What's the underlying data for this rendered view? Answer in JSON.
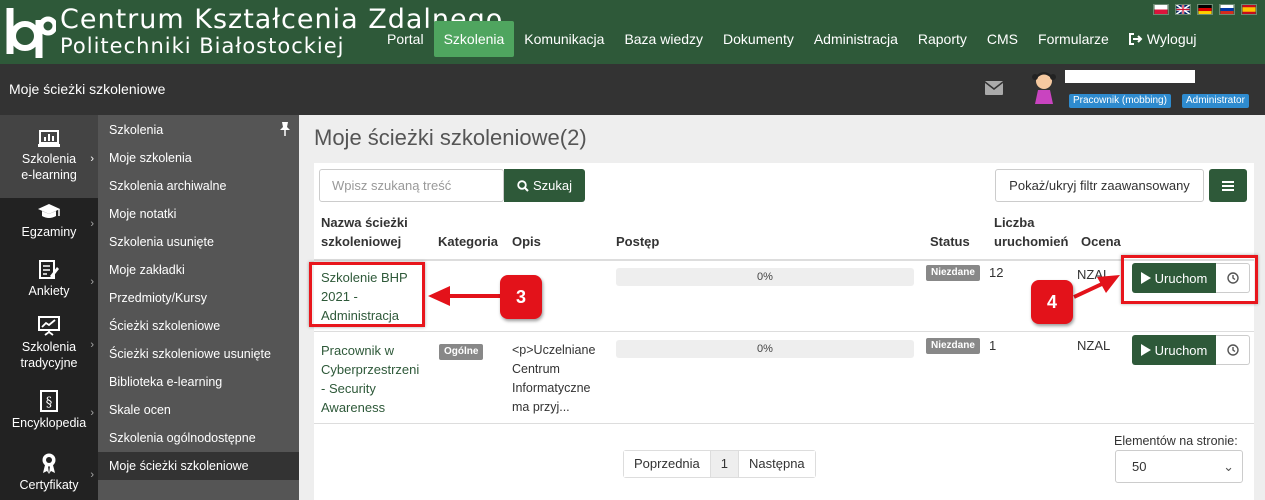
{
  "brand": {
    "line1": "Centrum Kształcenia Zdalnego",
    "line2": "Politechniki Białostockiej"
  },
  "nav": [
    {
      "label": "Portal",
      "active": false
    },
    {
      "label": "Szkolenia",
      "active": true
    },
    {
      "label": "Komunikacja",
      "active": false
    },
    {
      "label": "Baza wiedzy",
      "active": false
    },
    {
      "label": "Dokumenty",
      "active": false
    },
    {
      "label": "Administracja",
      "active": false
    },
    {
      "label": "Raporty",
      "active": false
    },
    {
      "label": "CMS",
      "active": false
    },
    {
      "label": "Formularze",
      "active": false
    },
    {
      "label": "Wyloguj",
      "active": false
    }
  ],
  "flags": [
    "flag-pl-icon",
    "flag-uk-icon",
    "flag-de-icon",
    "flag-ru-icon",
    "flag-es-icon"
  ],
  "subheader": {
    "title": "Moje ścieżki szkoleniowe"
  },
  "user": {
    "badges": [
      "Pracownik (mobbing)",
      "Administrator"
    ]
  },
  "iconbar": [
    {
      "label1": "Szkolenia",
      "label2": "e-learning",
      "icon": "elearning-icon",
      "active": true
    },
    {
      "label1": "Egzaminy",
      "label2": "",
      "icon": "graduation-cap-icon",
      "active": false
    },
    {
      "label1": "Ankiety",
      "label2": "",
      "icon": "survey-icon",
      "active": false
    },
    {
      "label1": "Szkolenia",
      "label2": "tradycyjne",
      "icon": "presentation-icon",
      "active": false
    },
    {
      "label1": "Encyklopedia",
      "label2": "",
      "icon": "encyclopedia-icon",
      "active": false
    },
    {
      "label1": "Certyfikaty",
      "label2": "",
      "icon": "certificate-icon",
      "active": false
    }
  ],
  "submenu": [
    "Szkolenia",
    "Moje szkolenia",
    "Szkolenia archiwalne",
    "Moje notatki",
    "Szkolenia usunięte",
    "Moje zakładki",
    "Przedmioty/Kursy",
    "Ścieżki szkoleniowe",
    "Ścieżki szkoleniowe usunięte",
    "Biblioteka e-learning",
    "Skale ocen",
    "Szkolenia ogólnodostępne",
    "Moje ścieżki szkoleniowe"
  ],
  "main": {
    "title": "Moje ścieżki szkoleniowe(2)",
    "search_placeholder": "Wpisz szukaną treść",
    "search_button": "Szukaj",
    "toggle_filter": "Pokaż/ukryj filtr zaawansowany"
  },
  "table": {
    "headers": {
      "name1": "Nazwa ścieżki",
      "name2": "szkoleniowej",
      "category": "Kategoria",
      "description": "Opis",
      "progress": "Postęp",
      "status": "Status",
      "runs1": "Liczba",
      "runs2": "uruchomień",
      "grade": "Ocena"
    },
    "rows": [
      {
        "name": [
          "Szkolenie BHP",
          "2021 -",
          "Administracja"
        ],
        "category": "",
        "description": [],
        "progress": "0%",
        "progress_value": 0,
        "status": "Niezdane",
        "runs": "12",
        "grade": "NZAL",
        "run_label": "Uruchom"
      },
      {
        "name": [
          "Pracownik w",
          "Cyberprzestrzeni",
          "- Security",
          "Awareness"
        ],
        "category": "Ogólne",
        "description": [
          "<p>Uczelniane",
          "Centrum",
          "Informatyczne",
          "ma przyj..."
        ],
        "progress": "0%",
        "progress_value": 0,
        "status": "Niezdane",
        "runs": "1",
        "grade": "NZAL",
        "run_label": "Uruchom"
      }
    ]
  },
  "pagination": {
    "prev": "Poprzednia",
    "current": "1",
    "next": "Następna"
  },
  "per_page": {
    "label": "Elementów na stronie:",
    "value": "50"
  },
  "annotations": {
    "step3": "3",
    "step4": "4",
    "color": "#e3121a"
  },
  "colors": {
    "header": "#2e5939",
    "nav_active": "#4fa55f",
    "button": "#2e5939",
    "badge_blue": "#2e8bcf"
  }
}
